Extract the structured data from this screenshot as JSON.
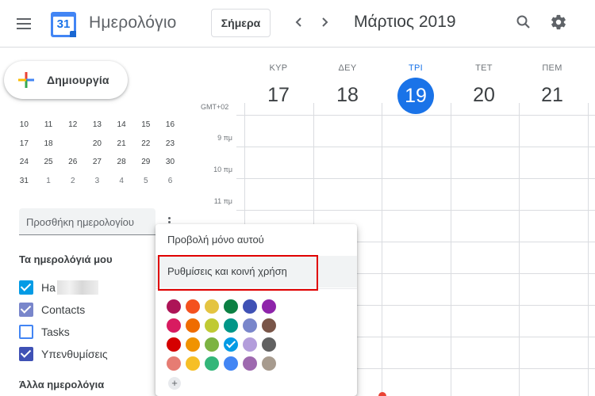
{
  "header": {
    "logo_day": "31",
    "app_title": "Ημερολόγιο",
    "today_label": "Σήμερα",
    "month_title": "Μάρτιος 2019"
  },
  "sidebar": {
    "create_label": "Δημιουργία",
    "mini_calendar": [
      [
        {
          "d": "10"
        },
        {
          "d": "11"
        },
        {
          "d": "12"
        },
        {
          "d": "13"
        },
        {
          "d": "14"
        },
        {
          "d": "15"
        },
        {
          "d": "16"
        }
      ],
      [
        {
          "d": "17"
        },
        {
          "d": "18"
        },
        {
          "d": "19",
          "today": true
        },
        {
          "d": "20"
        },
        {
          "d": "21"
        },
        {
          "d": "22"
        },
        {
          "d": "23"
        }
      ],
      [
        {
          "d": "24"
        },
        {
          "d": "25"
        },
        {
          "d": "26"
        },
        {
          "d": "27"
        },
        {
          "d": "28"
        },
        {
          "d": "29"
        },
        {
          "d": "30"
        }
      ],
      [
        {
          "d": "31"
        },
        {
          "d": "1",
          "other": true
        },
        {
          "d": "2",
          "other": true
        },
        {
          "d": "3",
          "other": true
        },
        {
          "d": "4",
          "other": true
        },
        {
          "d": "5",
          "other": true
        },
        {
          "d": "6",
          "other": true
        }
      ]
    ],
    "add_calendar_placeholder": "Προσθήκη ημερολογίου",
    "my_calendars_title": "Τα ημερολόγιά μου",
    "my_calendars": [
      {
        "label": "Ha",
        "checked": true,
        "color": "#039be5"
      },
      {
        "label": "Contacts",
        "checked": true,
        "color": "#7986cb"
      },
      {
        "label": "Tasks",
        "checked": false,
        "color": "#4285f4"
      },
      {
        "label": "Υπενθυμίσεις",
        "checked": true,
        "color": "#3f51b5"
      }
    ],
    "other_calendars_title": "Άλλα ημερολόγια"
  },
  "week": {
    "timezone": "GMT+02",
    "days": [
      {
        "dow": "ΚΥΡ",
        "num": "17",
        "today": false
      },
      {
        "dow": "ΔΕΥ",
        "num": "18",
        "today": false
      },
      {
        "dow": "ΤΡΙ",
        "num": "19",
        "today": true
      },
      {
        "dow": "ΤΕΤ",
        "num": "20",
        "today": false
      },
      {
        "dow": "ΠΕΜ",
        "num": "21",
        "today": false
      }
    ],
    "time_labels": [
      "9 πμ",
      "10 πμ",
      "11 πμ"
    ]
  },
  "popup": {
    "view_only_label": "Προβολή μόνο αυτού",
    "settings_label": "Ρυθμίσεις και κοινή χρήση",
    "colors": [
      [
        "#ad1457",
        "#f4511e",
        "#e4c441",
        "#0b8043",
        "#3f51b5",
        "#8e24aa"
      ],
      [
        "#d81b60",
        "#ef6c00",
        "#c0ca33",
        "#009688",
        "#7986cb",
        "#795548"
      ],
      [
        "#d50000",
        "#f09300",
        "#7cb342",
        "#039be5",
        "#b39ddb",
        "#616161"
      ],
      [
        "#e67c73",
        "#f6bf26",
        "#33b679",
        "#4285f4",
        "#9e69af",
        "#a79b8e"
      ]
    ],
    "selected_color": "#039be5",
    "add_color_label": "+"
  },
  "colors": {
    "accent": "#1a73e8",
    "highlight_box": "#e00000"
  }
}
